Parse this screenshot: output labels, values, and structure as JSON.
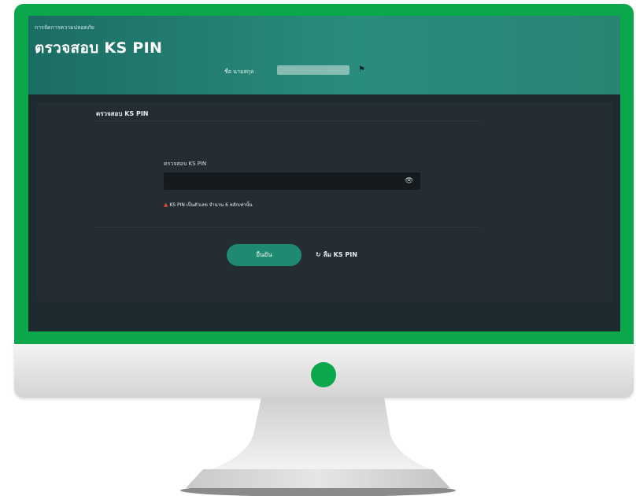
{
  "app": {
    "breadcrumb": "การจัดการความปลอดภัย",
    "title": "ตรวจสอบ KS PIN",
    "user_label": "ชื่อ นามสกุล",
    "user_icon": "shield-icon"
  },
  "card": {
    "title": "ตรวจสอบ KS PIN",
    "field_label": "ตรวจสอบ KS PIN",
    "field_value": "",
    "eye_icon": "eye-icon",
    "error_text": "KS PIN เป็นตัวเลข จำนวน 6 หลักเท่านั้น",
    "confirm_label": "ยืนยัน",
    "reset_label": "ลืม KS PIN"
  },
  "colors": {
    "frame_green": "#0aa84a",
    "header_teal": "#1b6d63",
    "button_teal": "#1f8a72",
    "error_red": "#e0443e"
  }
}
